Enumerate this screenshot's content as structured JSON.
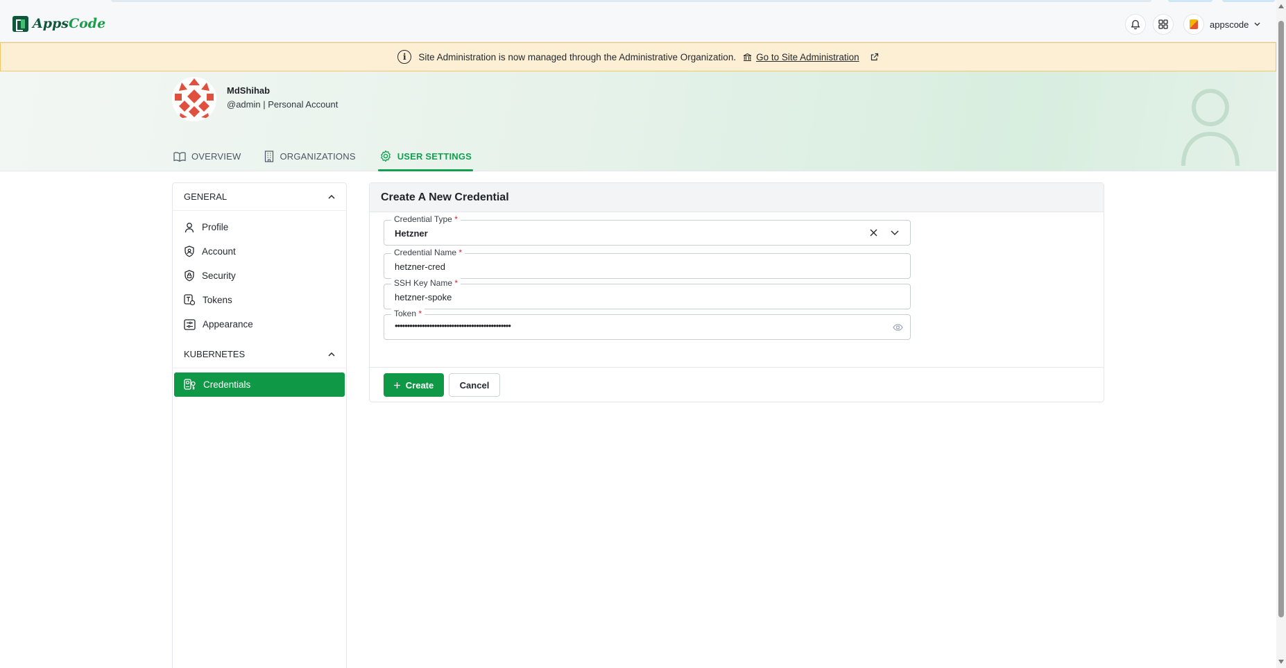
{
  "app": {
    "brand_left": "Apps",
    "brand_right": "Code"
  },
  "header": {
    "notifications_icon": "bell-icon",
    "apps_icon": "grid-icon",
    "user_name": "appscode",
    "user_menu_icon": "chevron-down-icon"
  },
  "banner": {
    "message": "Site Administration is now managed through the Administrative Organization.",
    "link_label": "Go to Site Administration",
    "colors": {
      "background": "#fcefd4",
      "border": "#f2c66d"
    }
  },
  "profile": {
    "name": "MdShihab",
    "subtitle": "@admin | Personal Account"
  },
  "tabs": [
    {
      "label": "OVERVIEW",
      "icon": "book-icon",
      "active": false
    },
    {
      "label": "ORGANIZATIONS",
      "icon": "building-icon",
      "active": false
    },
    {
      "label": "USER SETTINGS",
      "icon": "gear-icon",
      "active": true
    }
  ],
  "sidebar": {
    "sections": [
      {
        "title": "GENERAL",
        "items": [
          {
            "label": "Profile",
            "icon": "user-icon"
          },
          {
            "label": "Account",
            "icon": "shield-user-icon"
          },
          {
            "label": "Security",
            "icon": "shield-lock-icon"
          },
          {
            "label": "Tokens",
            "icon": "token-icon"
          },
          {
            "label": "Appearance",
            "icon": "appearance-icon"
          }
        ]
      },
      {
        "title": "KUBERNETES",
        "items": [
          {
            "label": "Credentials",
            "icon": "credentials-icon",
            "active": true
          }
        ]
      }
    ]
  },
  "form": {
    "title": "Create A New Credential",
    "fields": {
      "credential_type": {
        "label": "Credential Type",
        "required": "*",
        "value": "Hetzner"
      },
      "credential_name": {
        "label": "Credential Name",
        "required": "*",
        "value": "hetzner-cred"
      },
      "ssh_key_name": {
        "label": "SSH Key Name",
        "required": "*",
        "value": "hetzner-spoke"
      },
      "token": {
        "label": "Token",
        "required": "*",
        "value": "•••••••••••••••••••••••••••••••••••••••••••••••"
      }
    },
    "create_label": "Create",
    "cancel_label": "Cancel"
  },
  "colors": {
    "accent": "#0f9946",
    "required": "#d1242f"
  }
}
